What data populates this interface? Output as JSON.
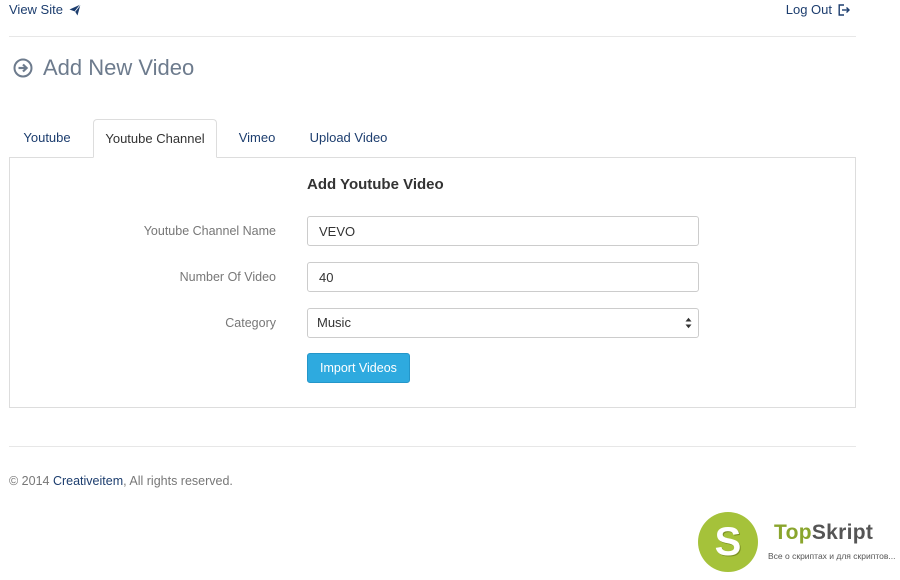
{
  "header": {
    "view_site": "View Site",
    "log_out": "Log Out"
  },
  "page": {
    "title": "Add New Video"
  },
  "tabs": [
    {
      "label": "Youtube",
      "active": false
    },
    {
      "label": "Youtube Channel",
      "active": true
    },
    {
      "label": "Vimeo",
      "active": false
    },
    {
      "label": "Upload Video",
      "active": false
    }
  ],
  "form": {
    "heading": "Add Youtube Video",
    "channel_label": "Youtube Channel Name",
    "channel_value": "VEVO",
    "count_label": "Number Of Video",
    "count_value": "40",
    "category_label": "Category",
    "category_value": "Music",
    "submit_label": "Import Videos"
  },
  "footer": {
    "prefix": "© 2014 ",
    "company": "Creativeitem",
    "suffix": ", All rights reserved."
  },
  "watermark": {
    "letter": "S",
    "name_top": "Top",
    "name_skript": "Skript",
    "tagline": "Все о скриптах и для скриптов..."
  },
  "colors": {
    "link": "#1c3d6e",
    "button": "#2eaadf",
    "title": "#6d7b8d",
    "watermark_green": "#a5c23a"
  },
  "icons": {
    "view_site": "paper-plane-icon",
    "log_out": "sign-out-icon",
    "title": "circle-arrow-right-icon",
    "select": "select-arrows-icon"
  }
}
